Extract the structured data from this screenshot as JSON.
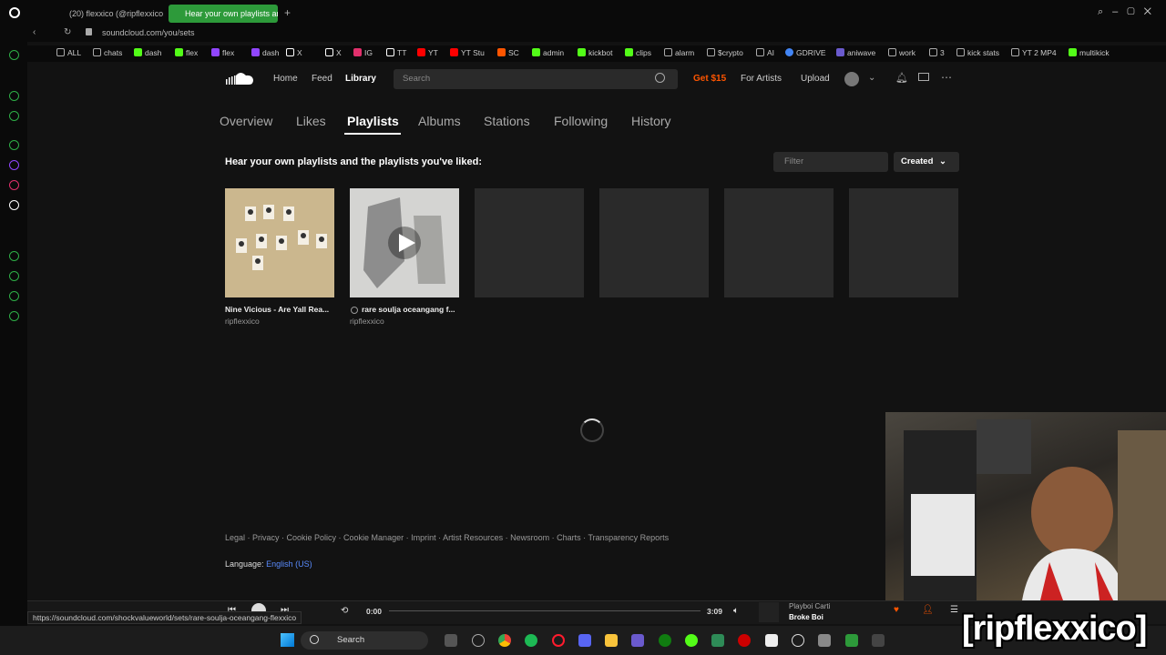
{
  "browser": {
    "tabs": [
      {
        "label": "(20) flexxico (@ripflexxico"
      },
      {
        "label": "Hear your own playlists ar"
      }
    ],
    "url": "soundcloud.com/you/sets",
    "bookmarks": [
      "ALL",
      "chats",
      "dash",
      "flex",
      "flex",
      "dash",
      "X",
      "IG",
      "TT",
      "YT",
      "YT Stu",
      "SC",
      "admin",
      "kickbot",
      "clips",
      "alarm",
      "$crypto",
      "AI",
      "GDRIVE",
      "aniwave",
      "work",
      "3",
      "kick stats",
      "YT 2 MP4",
      "multikick"
    ]
  },
  "header": {
    "nav": [
      "Home",
      "Feed",
      "Library"
    ],
    "search_placeholder": "Search",
    "get_label": "Get $15",
    "for_artists": "For Artists",
    "upload": "Upload"
  },
  "library_tabs": [
    "Overview",
    "Likes",
    "Playlists",
    "Albums",
    "Stations",
    "Following",
    "History"
  ],
  "heading": "Hear your own playlists and the playlists you've liked:",
  "filter_placeholder": "Filter",
  "sort_label": "Created",
  "playlists": [
    {
      "title": "Nine Vicious - Are Yall Rea...",
      "user": "ripflexxico"
    },
    {
      "title": "rare soulja oceangang f...",
      "user": "ripflexxico"
    }
  ],
  "footer": {
    "links": "Legal · Privacy · Cookie Policy · Cookie Manager · Imprint · Artist Resources · Newsroom · Charts · Transparency Reports",
    "language_label": "Language:",
    "language_value": "English (US)"
  },
  "player": {
    "current_time": "0:00",
    "duration": "3:09",
    "artist": "Playboi Carti",
    "track": "Broke Boi"
  },
  "status_url": "https://soundcloud.com/shockvalueworld/sets/rare-soulja-oceangang-flexxico",
  "taskbar": {
    "search_label": "Search"
  },
  "watermark": "[ripflexxico]",
  "colors": {
    "accent": "#ff5500",
    "browser_green": "#2d9a3a"
  }
}
